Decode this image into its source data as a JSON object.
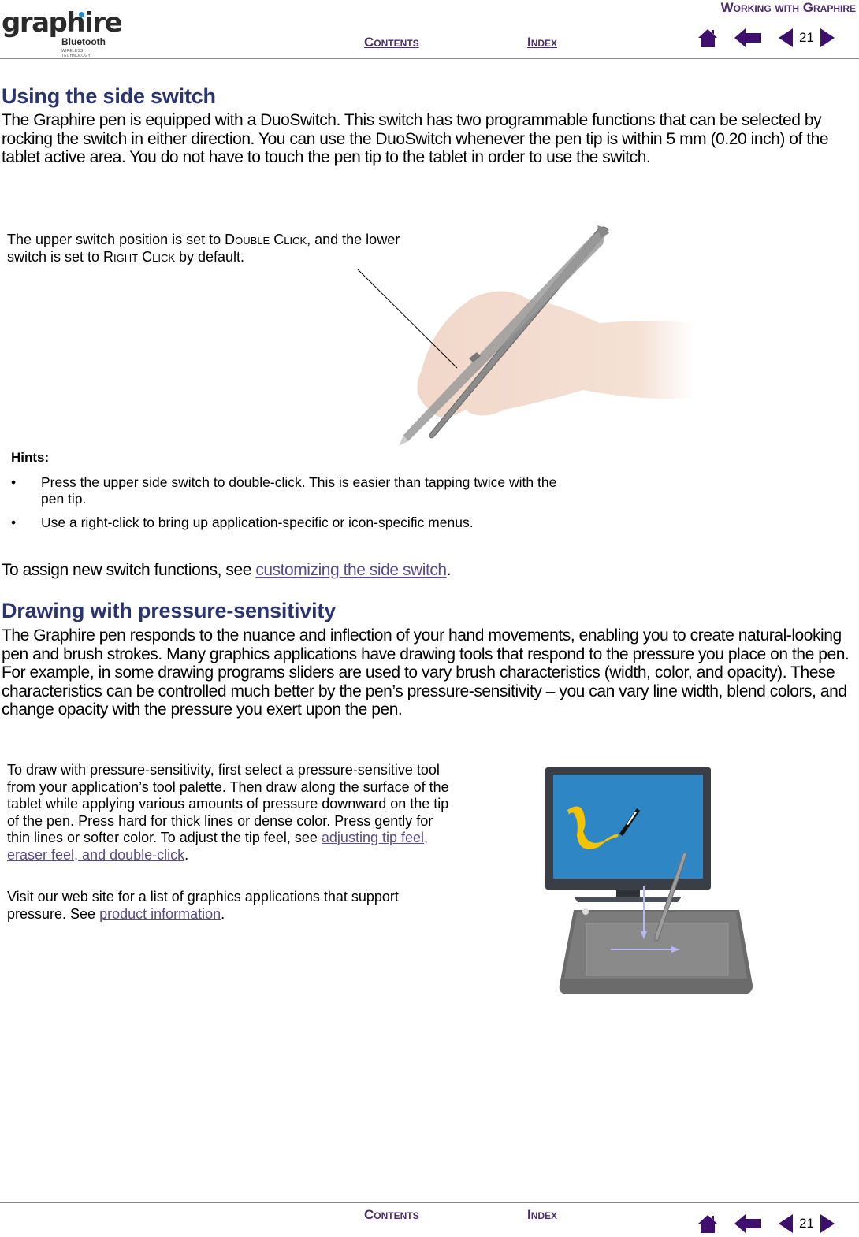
{
  "header": {
    "logo": {
      "word": "graphire",
      "sub": "Bluetooth",
      "tag": "WIRELESS TECHNOLOGY"
    },
    "chapter_link": "Working with Graphire",
    "contents_label": "Contents",
    "index_label": "Index",
    "page_number": "21",
    "icons": [
      "home-icon",
      "back-icon",
      "previous-page-icon",
      "next-page-icon"
    ]
  },
  "section1": {
    "title": "Using the side switch",
    "paragraph": "The Graphire pen is equipped with a DuoSwitch.  This switch has two programmable functions that can be selected by rocking the switch in either direction.  You can use the DuoSwitch whenever the pen tip is within 5 mm (0.20 inch) of the tablet active area.  You do not have to touch the pen tip to the tablet in order to use the switch.",
    "callout": {
      "part1": "The upper switch position is set to ",
      "double_click": "Double Click",
      "part2": ", and the lower switch is set to ",
      "right_click": "Right Click",
      "part3": " by default."
    },
    "hints_title": "Hints:",
    "hints": [
      "Press the upper side switch to double-click.  This is easier than tapping twice with the pen tip.",
      "Use a right-click to bring up application-specific or icon-specific menus."
    ],
    "assign_text": "To assign new switch functions, see ",
    "assign_link": "customizing the side switch",
    "assign_end": "."
  },
  "section2": {
    "title": "Drawing with pressure-sensitivity",
    "paragraph": "The Graphire pen responds to the nuance and inflection of your hand movements, enabling you to create natural-looking pen and brush strokes.  Many graphics applications have drawing tools that respond to the pressure you place on the pen.  For example, in some drawing programs sliders are used to vary brush characteristics (width, color, and opacity).  These characteristics can be controlled much better by the pen’s pressure-sensitivity – you can vary line width, blend colors, and change opacity with the pressure you exert upon the pen.",
    "side_text": "To draw with pressure-sensitivity, first select a pressure-sensitive tool from your application’s tool palette.  Then draw along the surface of the tablet while applying various amounts of pressure downward on the tip of the pen.  Press hard for thick lines or dense color.  Press gently for thin lines or softer color.  To adjust the tip feel, see ",
    "side_link": "adjusting tip feel, eraser feel, and double-click",
    "side_end": ".",
    "visit_text": "Visit our web site for a list of graphics applications that support pressure.  See ",
    "visit_link": "product information",
    "visit_end": "."
  },
  "footer": {
    "contents_label": "Contents",
    "index_label": "Index",
    "page_number": "21"
  },
  "colors": {
    "heading": "#2a3470",
    "nav": "#3f0f6e",
    "link": "#5a4a8a",
    "screen_blue": "#2f86c4",
    "stroke_yellow": "#f5c400"
  }
}
